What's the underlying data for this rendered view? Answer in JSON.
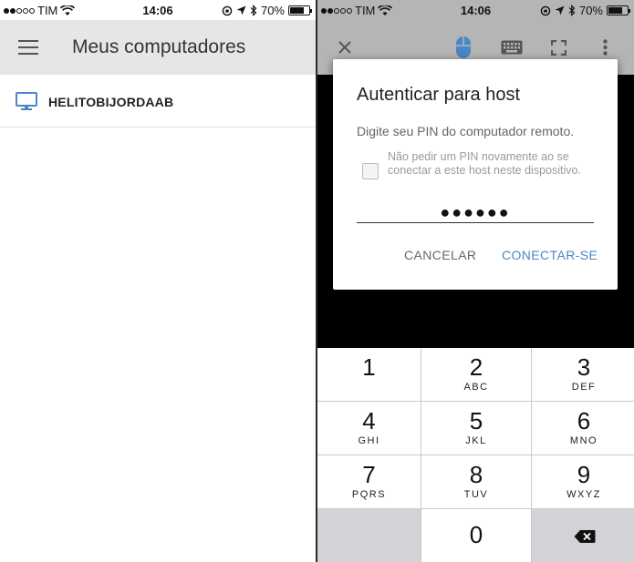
{
  "status_bar": {
    "carrier": "TIM",
    "time": "14:06",
    "battery": "70%"
  },
  "left": {
    "title": "Meus computadores",
    "hosts": [
      {
        "name": "HELITOBIJORDAAB"
      }
    ]
  },
  "right": {
    "toolbar_icons": [
      "close-icon",
      "mouse-icon",
      "keyboard-icon",
      "fullscreen-icon",
      "more-vert-icon"
    ],
    "dialog": {
      "title": "Autenticar para host",
      "message": "Digite seu PIN do computador remoto.",
      "checkbox_label": "Não pedir um PIN novamente ao se conectar a este host neste dispositivo.",
      "checkbox_checked": false,
      "pin_value": "●●●●●●",
      "cancel_label": "CANCELAR",
      "connect_label": "CONECTAR-SE"
    },
    "keypad": [
      {
        "num": "1",
        "letters": ""
      },
      {
        "num": "2",
        "letters": "ABC"
      },
      {
        "num": "3",
        "letters": "DEF"
      },
      {
        "num": "4",
        "letters": "GHI"
      },
      {
        "num": "5",
        "letters": "JKL"
      },
      {
        "num": "6",
        "letters": "MNO"
      },
      {
        "num": "7",
        "letters": "PQRS"
      },
      {
        "num": "8",
        "letters": "TUV"
      },
      {
        "num": "9",
        "letters": "WXYZ"
      },
      {
        "num": "0",
        "letters": ""
      }
    ]
  },
  "colors": {
    "accent": "#4a86c8",
    "appbar_left": "#e6e6e6",
    "toolbar_right": "#b5b5b5"
  }
}
